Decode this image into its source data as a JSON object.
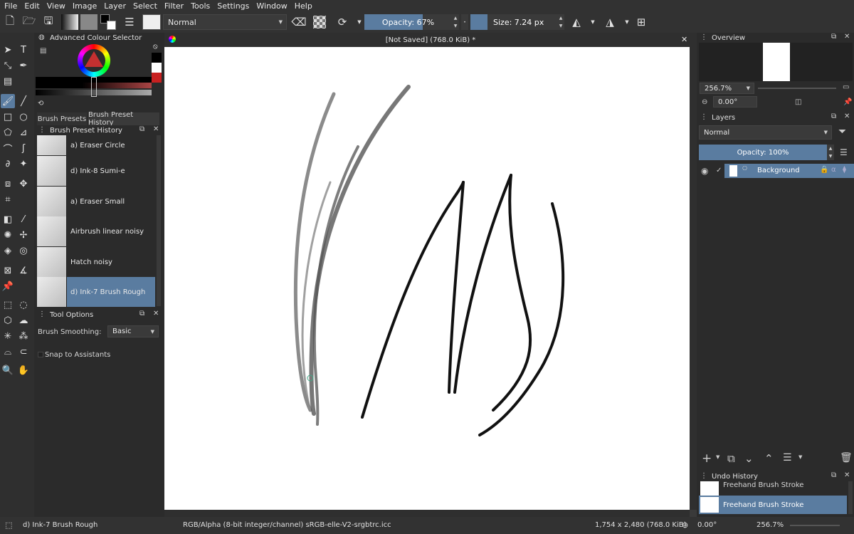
{
  "menu": [
    "File",
    "Edit",
    "View",
    "Image",
    "Layer",
    "Select",
    "Filter",
    "Tools",
    "Settings",
    "Window",
    "Help"
  ],
  "toolbar": {
    "blend_mode": "Normal",
    "opacity_label": "Opacity: 67%",
    "opacity_value": 67,
    "size_label": "Size: 7.24 px"
  },
  "colour_selector": {
    "title": "Advanced Colour Selector"
  },
  "brush_tabs": [
    "Brush Presets",
    "Brush Preset History"
  ],
  "brush_history": {
    "title": "Brush Preset History",
    "items": [
      {
        "label": "a) Eraser Circle"
      },
      {
        "label": "d) Ink-8 Sumi-e"
      },
      {
        "label": "a) Eraser Small"
      },
      {
        "label": "Airbrush linear noisy"
      },
      {
        "label": "Hatch noisy"
      },
      {
        "label": "d) Ink-7 Brush Rough"
      }
    ]
  },
  "tool_options": {
    "title": "Tool Options",
    "smoothing_label": "Brush Smoothing:",
    "smoothing_value": "Basic",
    "snap_label": "Snap to Assistants"
  },
  "document": {
    "tab_title": "[Not Saved]  (768.0 KiB) *"
  },
  "overview": {
    "title": "Overview",
    "zoom": "256.7%",
    "rotation": "0.00°"
  },
  "layers": {
    "title": "Layers",
    "blend_mode": "Normal",
    "opacity_label": "Opacity: 100%",
    "items": [
      {
        "name": "Background"
      }
    ]
  },
  "undo_history": {
    "title": "Undo History",
    "items": [
      "Freehand Brush Stroke",
      "Freehand Brush Stroke"
    ]
  },
  "status": {
    "brush": "d) Ink-7 Brush Rough",
    "color_space": "RGB/Alpha (8-bit integer/channel)  sRGB-elle-V2-srgbtrc.icc",
    "dimensions": "1,754 x 2,480 (768.0 KiB)",
    "rotation": "0.00°",
    "zoom": "256.7%"
  },
  "colors": {
    "accent": "#5a7ca0",
    "panel": "#2b2b2b",
    "canvas": "#ffffff"
  }
}
